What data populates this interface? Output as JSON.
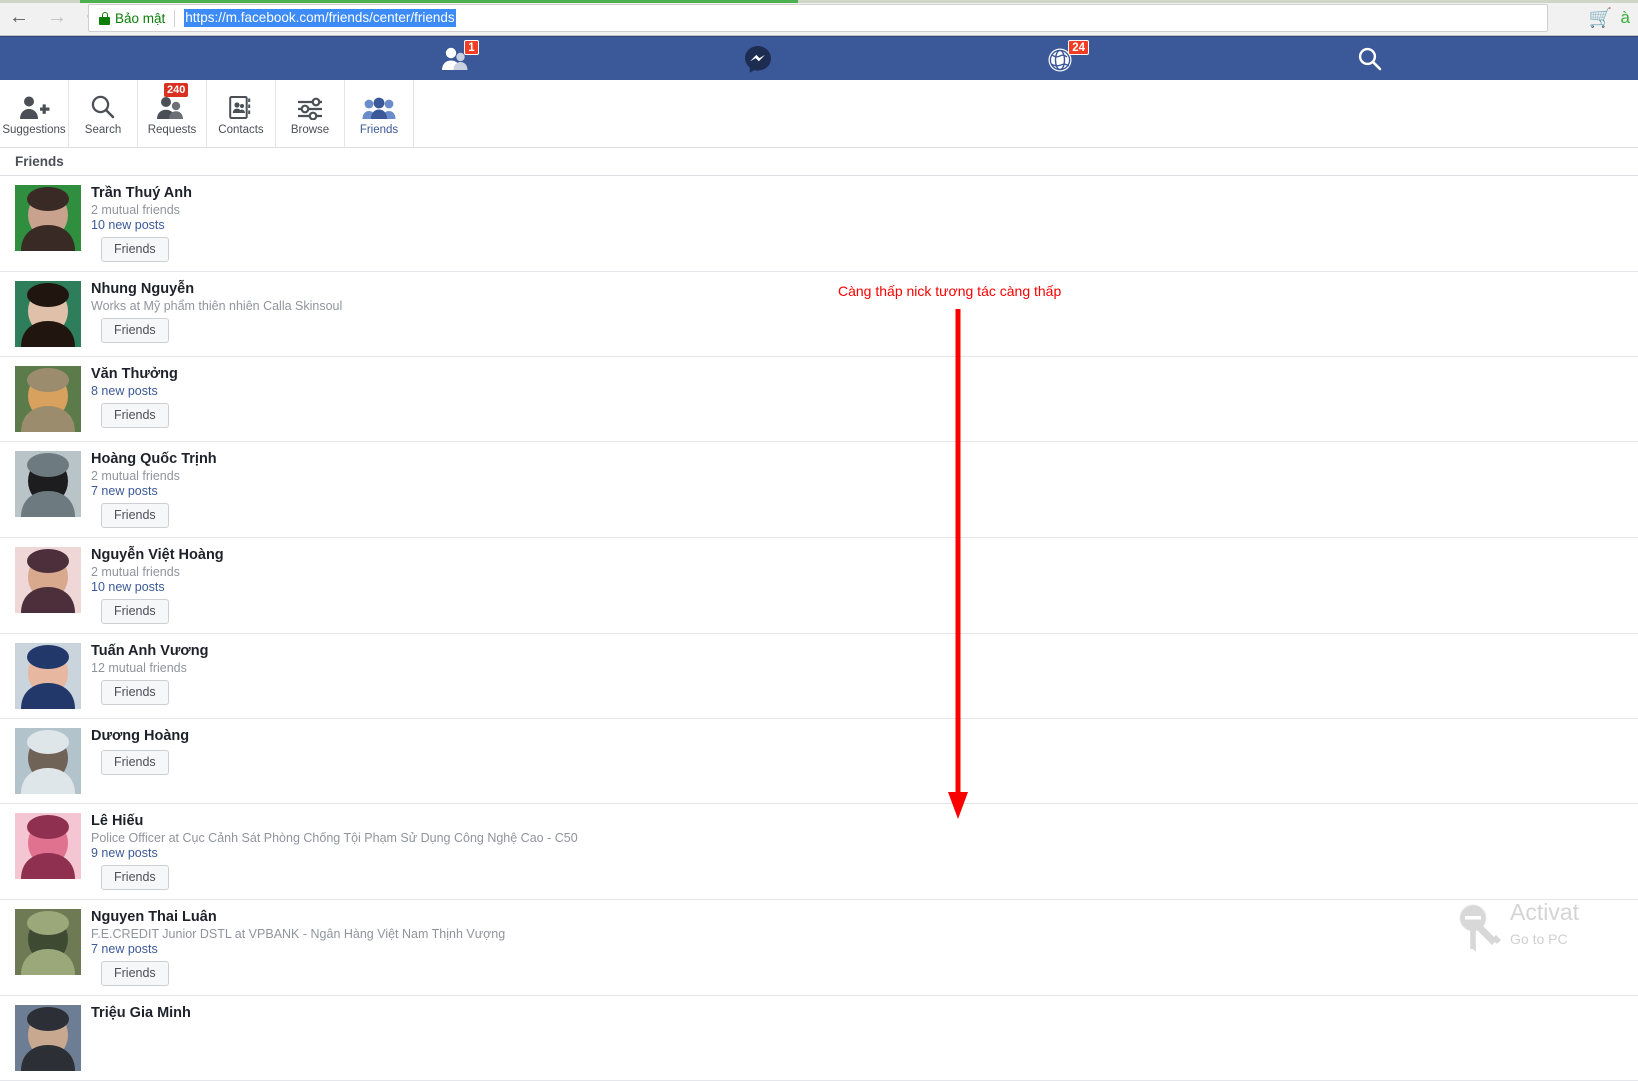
{
  "browser": {
    "back_icon": "back-arrow-icon",
    "forward_icon": "forward-arrow-icon",
    "reload_icon": "reload-icon",
    "secure_label": "Bảo mật",
    "url": "https://m.facebook.com/friends/center/friends",
    "cart_icon": "shopping-cart-icon",
    "profile_letter": "à",
    "accent_green": "#0a7e07",
    "url_selection_blue": "#3d8bf7"
  },
  "fb_topbar": {
    "background": "#3b5998",
    "items": [
      {
        "name": "friend-requests",
        "icon": "friend-requests-icon",
        "badge": "1"
      },
      {
        "name": "messages",
        "icon": "messenger-icon",
        "badge": ""
      },
      {
        "name": "notifications",
        "icon": "globe-notifications-icon",
        "badge": "24"
      },
      {
        "name": "search",
        "icon": "search-icon",
        "badge": ""
      }
    ],
    "badge_color": "#f03d25"
  },
  "tabs": [
    {
      "label": "Suggestions",
      "icon": "person-add-icon",
      "badge": "",
      "active": false
    },
    {
      "label": "Search",
      "icon": "search-icon",
      "badge": "",
      "active": false
    },
    {
      "label": "Requests",
      "icon": "friend-requests-icon",
      "badge": "240",
      "active": false
    },
    {
      "label": "Contacts",
      "icon": "address-book-icon",
      "badge": "",
      "active": false
    },
    {
      "label": "Browse",
      "icon": "sliders-icon",
      "badge": "",
      "active": false
    },
    {
      "label": "Friends",
      "icon": "people-icon",
      "badge": "",
      "active": true
    }
  ],
  "section": {
    "title": "Friends"
  },
  "friends": [
    {
      "name": "Trần Thuý Anh",
      "subtitle": "2 mutual friends",
      "posts": "10 new posts",
      "button": "Friends",
      "avatar_colors": [
        "#2f8f3e",
        "#c8a28c",
        "#3a2a26"
      ]
    },
    {
      "name": "Nhung Nguyễn",
      "subtitle": "Works at Mỹ phẩm thiên nhiên Calla Skinsoul",
      "posts": "",
      "button": "Friends",
      "avatar_colors": [
        "#2e7d5b",
        "#e0c0a8",
        "#20150f"
      ]
    },
    {
      "name": "Văn Thưởng",
      "subtitle": "",
      "posts": "8 new posts",
      "button": "Friends",
      "avatar_colors": [
        "#5b7b4a",
        "#d9a15e",
        "#9b8c6e"
      ]
    },
    {
      "name": "Hoàng Quốc Trịnh",
      "subtitle": "2 mutual friends",
      "posts": "7 new posts",
      "button": "Friends",
      "avatar_colors": [
        "#b9c4c9",
        "#1d1d1f",
        "#6d7a80"
      ]
    },
    {
      "name": "Nguyễn Việt Hoàng",
      "subtitle": "2 mutual friends",
      "posts": "10 new posts",
      "button": "Friends",
      "avatar_colors": [
        "#f0d7d7",
        "#d8a98d",
        "#4d2f3c"
      ]
    },
    {
      "name": "Tuấn Anh Vương",
      "subtitle": "12 mutual friends",
      "posts": "",
      "button": "Friends",
      "avatar_colors": [
        "#c9d4dd",
        "#e8b7a0",
        "#22386b"
      ]
    },
    {
      "name": "Dương Hoàng",
      "subtitle": "",
      "posts": "",
      "button": "Friends",
      "avatar_colors": [
        "#b3c3cc",
        "#6f6257",
        "#dfe6ea"
      ]
    },
    {
      "name": "Lê Hiếu",
      "subtitle": "Police Officer at Cục Cảnh Sát Phòng Chống Tội Phạm Sử Dụng Công Nghệ Cao - C50",
      "posts": "9 new posts",
      "button": "Friends",
      "avatar_colors": [
        "#f4c6d4",
        "#e0718f",
        "#8f3050"
      ]
    },
    {
      "name": "Nguyen Thai Luân",
      "subtitle": "F.E.CREDIT Junior DSTL at VPBANK - Ngân Hàng Việt Nam Thịnh Vượng",
      "posts": "7 new posts",
      "button": "Friends",
      "avatar_colors": [
        "#6e7a54",
        "#3f4a33",
        "#9aa87a"
      ]
    },
    {
      "name": "Triệu Gia Minh",
      "subtitle": "",
      "posts": "",
      "button": "",
      "avatar_colors": [
        "#6d7d93",
        "#c8a98f",
        "#2c2f36"
      ]
    }
  ],
  "annotation": {
    "text": "Càng thấp nick tương tác càng thấp",
    "color": "#fb0000",
    "arrow_icon": "downward-arrow-icon"
  },
  "watermark": {
    "title": "Activat",
    "subtitle": "Go to PC",
    "icon": "key-icon",
    "color": "#d4d4d4"
  }
}
